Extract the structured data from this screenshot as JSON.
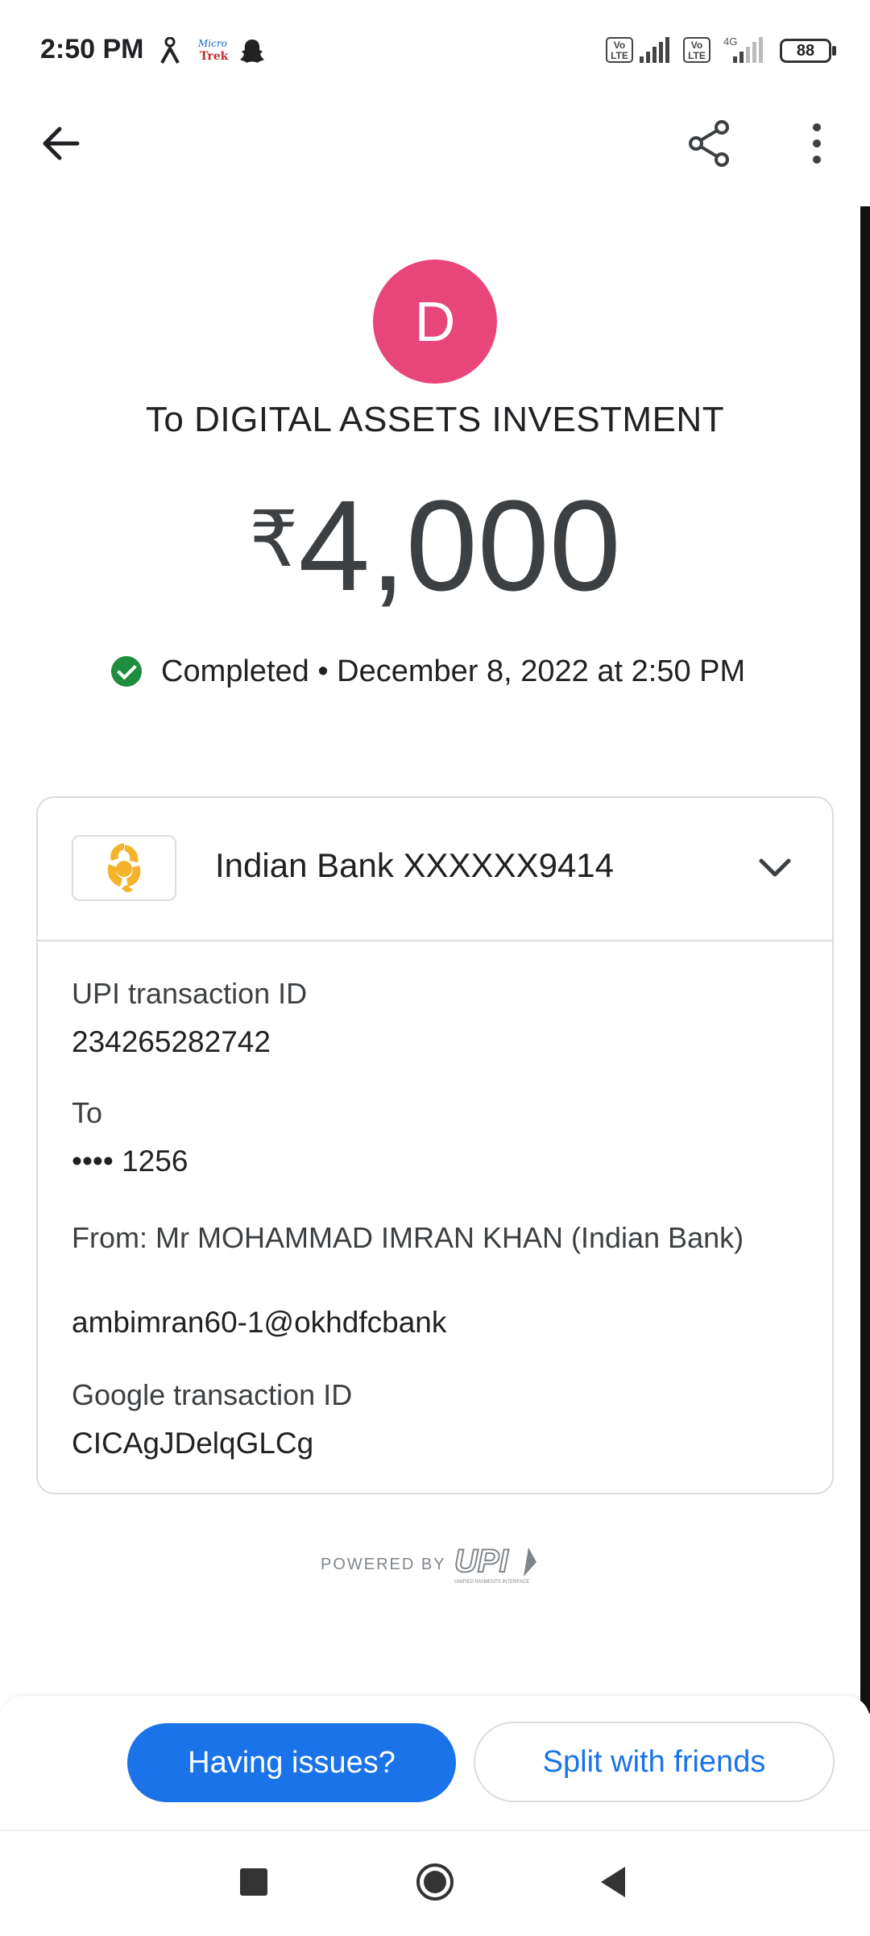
{
  "status_bar": {
    "time": "2:50 PM",
    "volte_label": "Vo LTE",
    "network_label": "4G",
    "battery": "88",
    "icons": [
      "person-icon",
      "microtrek-app-icon",
      "snapchat-ghost-icon",
      "volte-icon",
      "signal-icon",
      "volte-icon",
      "signal-4g-icon",
      "battery-icon"
    ]
  },
  "app_bar": {
    "back_icon": "arrow-back-icon",
    "share_icon": "share-icon",
    "more_icon": "more-vert-icon"
  },
  "transaction": {
    "avatar_letter": "D",
    "avatar_color": "#e8467a",
    "payee": "To DIGITAL ASSETS INVESTMENT",
    "currency_symbol": "₹",
    "amount": "4,000",
    "status": "Completed • December 8, 2022 at 2:50 PM",
    "status_color": "#1e8e3e"
  },
  "card": {
    "bank_name": "Indian Bank XXXXXX9414",
    "bank_logo_color": "#f4b32a",
    "details": {
      "upi_id_label": "UPI transaction ID",
      "upi_id_value": "234265282742",
      "to_label": "To",
      "to_value": "•••• 1256",
      "from_label": "From: Mr MOHAMMAD IMRAN KHAN (Indian Bank)",
      "from_value": "ambimran60-1@okhdfcbank",
      "google_id_label": "Google transaction ID",
      "google_id_value": "CICAgJDelqGLCg"
    }
  },
  "footer": {
    "powered_by": "POWERED BY",
    "upi_logo_text": "UPI",
    "upi_tagline": "UNIFIED PAYMENTS INTERFACE"
  },
  "actions": {
    "issues_label": "Having issues?",
    "split_label": "Split with friends",
    "accent": "#1a73e8"
  }
}
